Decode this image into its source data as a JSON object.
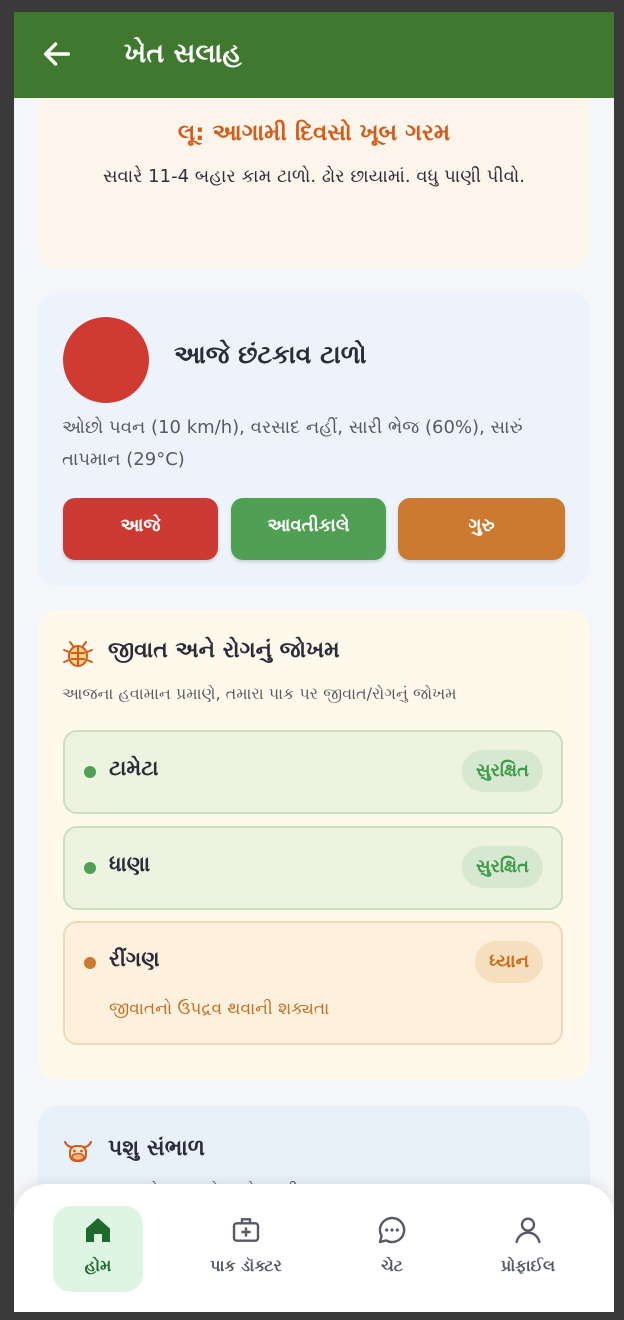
{
  "app_bar": {
    "title": "ખેત સલાહ",
    "back_icon": "arrow-left-icon"
  },
  "heat_alert": {
    "title": "લૂ: આગામી દિવસો ખૂબ ગરમ",
    "text": "સવારે 11-4 બહાર કામ ટાળો. ઢોર છાયામાં. વધુ પાણી પીવો."
  },
  "spray_advice": {
    "status_color": "#cf3a32",
    "title": "આજે છંટકાવ ટાળો",
    "description": "ઓછો પવન (10 km/h), વરસાદ નહીં, સારી ભેજ (60%), સારું તાપમાન (29°C)",
    "buttons": {
      "today": "આજે",
      "tomorrow": "આવતીકાલે",
      "guru": "ગુરુ"
    }
  },
  "pest_risk": {
    "icon": "bug-icon",
    "title": "જીવાત અને રોગનું જોખમ",
    "subtitle": "આજના હવામાન પ્રમાણે, તમારા પાક પર જીવાત/રોગનું જોખમ",
    "crops": [
      {
        "name": "ટામેટા",
        "status": "સુરક્ષિત",
        "level": "safe"
      },
      {
        "name": "ધાણા",
        "status": "સુરક્ષિત",
        "level": "safe"
      },
      {
        "name": "રીંગણ",
        "status": "ધ્યાન",
        "level": "warn",
        "note": "જીવાતનો ઉપદ્રવ થવાની શક્યતા"
      }
    ]
  },
  "cattle_care": {
    "icon": "cow-icon",
    "title": "પશુ સંભાળ",
    "subtitle": "હવામાન પ્રમાણે તમારા ઢોર માટે ગરમી સલાહ"
  },
  "bottom_nav": {
    "items": [
      {
        "label": "હોમ",
        "icon": "home-icon",
        "active": true
      },
      {
        "label": "પાક ડૉક્ટર",
        "icon": "medical-kit-icon"
      },
      {
        "label": "ચેટ",
        "icon": "chat-icon"
      },
      {
        "label": "પ્રોફાઈલ",
        "icon": "profile-icon"
      }
    ]
  },
  "colors": {
    "primary": "#41782f",
    "danger": "#cd3a33",
    "success": "#4fa052",
    "warning": "#cc7a30"
  }
}
